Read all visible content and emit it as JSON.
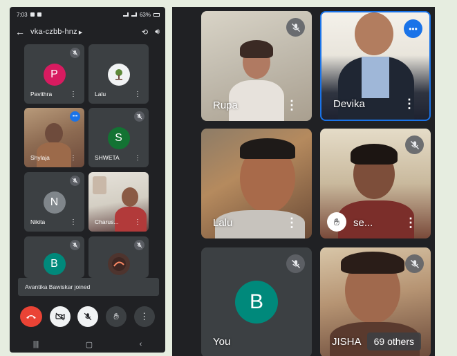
{
  "phone": {
    "status": {
      "time": "7:03",
      "battery": "63%"
    },
    "meeting_code": "vka-czbb-hnz",
    "tiles": [
      {
        "name": "Pavithra",
        "initial": "P",
        "color": "#d81b60",
        "avatar": "letter",
        "state": "muted"
      },
      {
        "name": "Lalu",
        "initial": "",
        "color": "#f1f3f4",
        "avatar": "image",
        "state": "none"
      },
      {
        "name": "Shylaja",
        "initial": "",
        "color": "",
        "avatar": "video",
        "state": "speaking"
      },
      {
        "name": "SHWETA",
        "initial": "S",
        "color": "#137333",
        "avatar": "letter",
        "state": "muted"
      },
      {
        "name": "Nikita",
        "initial": "N",
        "color": "#80868b",
        "avatar": "letter",
        "state": "muted"
      },
      {
        "name": "Charus...",
        "initial": "",
        "color": "",
        "avatar": "video",
        "state": "none"
      },
      {
        "name": "",
        "initial": "B",
        "color": "#00897b",
        "avatar": "letter",
        "state": "muted"
      },
      {
        "name": "",
        "initial": "",
        "color": "",
        "avatar": "image",
        "state": "muted"
      }
    ],
    "toast": "Avantika Bawiskar joined"
  },
  "meet": {
    "tiles": [
      {
        "name": "Rupa",
        "state": "muted"
      },
      {
        "name": "Devika",
        "state": "speaking"
      },
      {
        "name": "Lalu",
        "state": "none"
      },
      {
        "name": "se...",
        "state": "muted",
        "hand_raised": true
      },
      {
        "name": "You",
        "initial": "B",
        "color": "#00897b",
        "state": "muted"
      },
      {
        "name": "JISHA",
        "state": "muted"
      }
    ],
    "others_label": "69 others"
  }
}
